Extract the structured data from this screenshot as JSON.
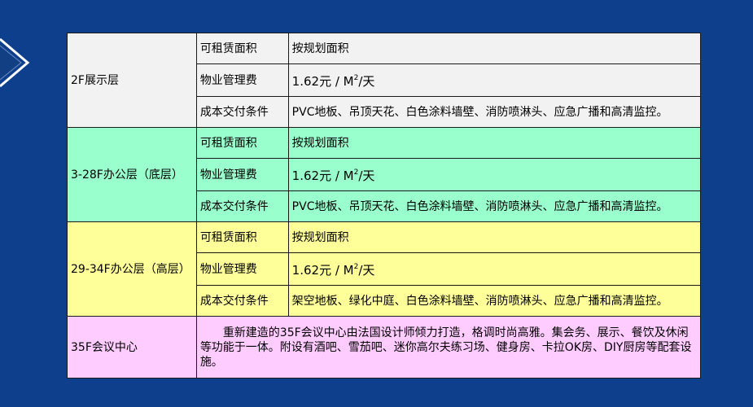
{
  "sections": [
    {
      "floor": "2F展示层",
      "rows": [
        {
          "label": "可租赁面积",
          "value": "按规划面积"
        },
        {
          "label": "物业管理费",
          "value_prefix": "1.62元 / M",
          "value_sup": "2",
          "value_suffix": "/天"
        },
        {
          "label": "成本交付条件",
          "value": "PVC地板、吊顶天花、白色涂料墙壁、消防喷淋头、应急广播和高清监控。"
        }
      ]
    },
    {
      "floor": "3-28F办公层（底层）",
      "rows": [
        {
          "label": "可租赁面积",
          "value": "按规划面积"
        },
        {
          "label": "物业管理费",
          "value_prefix": "1.62元 / M",
          "value_sup": "2",
          "value_suffix": "/天"
        },
        {
          "label": "成本交付条件",
          "value": "PVC地板、吊顶天花、白色涂料墙壁、消防喷淋头、应急广播和高清监控。"
        }
      ]
    },
    {
      "floor": "29-34F办公层（高层）",
      "rows": [
        {
          "label": "可租赁面积",
          "value": "按规划面积"
        },
        {
          "label": "物业管理费",
          "value_prefix": "1.62元 / M",
          "value_sup": "2",
          "value_suffix": "/天"
        },
        {
          "label": "成本交付条件",
          "value": "架空地板、绿化中庭、白色涂料墙壁、消防喷淋头、应急广播和高清监控。"
        }
      ]
    }
  ],
  "conference": {
    "floor": "35F会议中心",
    "description": "重新建造的35F会议中心由法国设计师倾力打造，格调时尚高雅。集会务、展示、餐饮及休闲等功能于一体。附设有酒吧、雪茄吧、迷你高尔夫练习场、健身房、卡拉OK房、DIY厨房等配套设施。"
  },
  "colors": {
    "background": "#0d3f8c",
    "section_1": "#f2f2f2",
    "section_2": "#99ffcc",
    "section_3": "#ffff99",
    "section_4": "#ffccff"
  }
}
